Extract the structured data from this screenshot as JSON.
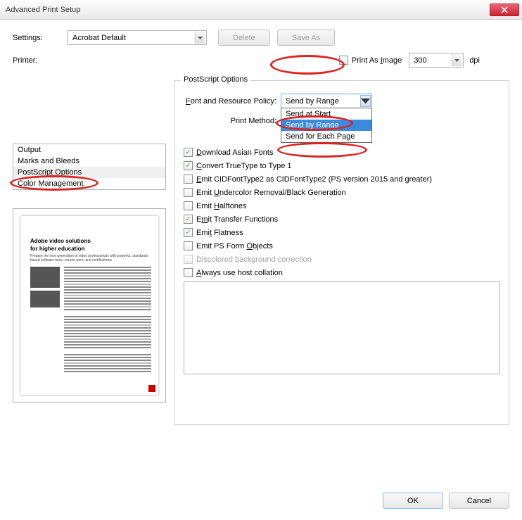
{
  "window": {
    "title": "Advanced Print Setup"
  },
  "settings_row": {
    "label": "Settings:",
    "value": "Acrobat Default",
    "delete": "Delete",
    "save_as": "Save As"
  },
  "printer_row": {
    "label": "Printer:",
    "print_as_image_prefix": "Print As ",
    "print_as_image_letter": "I",
    "print_as_image_suffix": "mage",
    "dpi_value": "300",
    "dpi_label": "dpi"
  },
  "sidebar": {
    "items": [
      "Output",
      "Marks and Bleeds",
      "PostScript Options",
      "Color Management"
    ],
    "selected": 2
  },
  "preview": {
    "headline1": "Adobe video solutions",
    "headline2": "for higher education",
    "sub": "Prepare the next generation of video professionals with powerful, standards-based software tools, course work, and certifications"
  },
  "group": {
    "title": "PostScript Options",
    "font_policy_prefix": "F",
    "font_policy_rest": "ont and Resource Policy:",
    "font_policy_selected": "Send by Range",
    "font_policy_options": [
      "Send at Start",
      "Send by Range",
      "Send for Each Page"
    ],
    "print_method_label": "Print Method:",
    "checks": [
      {
        "label_pre": "",
        "u": "D",
        "label_post": "ownload Asian Fonts",
        "checked": true
      },
      {
        "label_pre": "",
        "u": "C",
        "label_post": "onvert TrueType to Type 1",
        "checked": true
      },
      {
        "label_pre": "",
        "u": "E",
        "label_post": "mit CIDFontType2 as CIDFontType2 (PS version 2015 and greater)",
        "checked": false
      },
      {
        "label_pre": "Emit ",
        "u": "U",
        "label_post": "ndercolor Removal/Black Generation",
        "checked": false
      },
      {
        "label_pre": "Emit ",
        "u": "H",
        "label_post": "alftones",
        "checked": false
      },
      {
        "label_pre": "E",
        "u": "m",
        "label_post": "it Transfer Functions",
        "checked": true
      },
      {
        "label_pre": "Emi",
        "u": "t",
        "label_post": " Flatness",
        "checked": true
      },
      {
        "label_pre": "Emit PS Form ",
        "u": "O",
        "label_post": "bjects",
        "checked": false
      }
    ],
    "discolored": "Discolored background correction",
    "always_host_pre": "",
    "always_host_u": "A",
    "always_host_post": "lways use host collation"
  },
  "footer": {
    "ok": "OK",
    "cancel": "Cancel"
  }
}
